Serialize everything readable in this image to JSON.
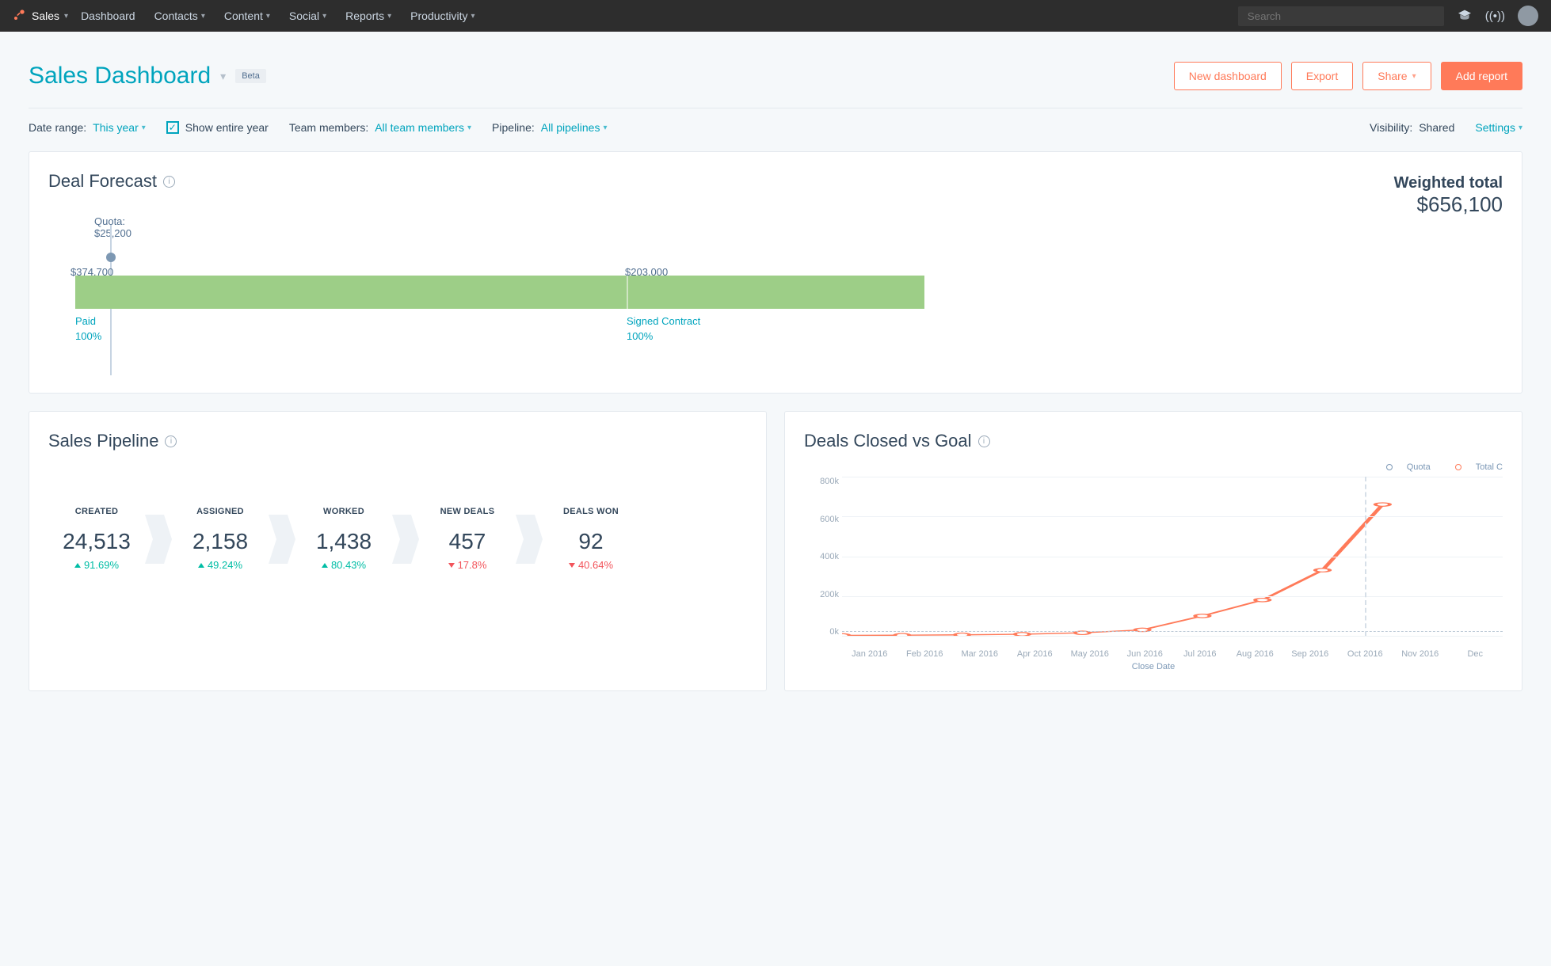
{
  "nav": {
    "brand": "Sales",
    "items": [
      "Dashboard",
      "Contacts",
      "Content",
      "Social",
      "Reports",
      "Productivity"
    ],
    "search_placeholder": "Search"
  },
  "header": {
    "title": "Sales Dashboard",
    "beta": "Beta",
    "buttons": {
      "new_dashboard": "New dashboard",
      "export": "Export",
      "share": "Share",
      "add_report": "Add report"
    }
  },
  "filters": {
    "date_range_label": "Date range:",
    "date_range_value": "This year",
    "show_entire_year": "Show entire year",
    "team_label": "Team members:",
    "team_value": "All team members",
    "pipeline_label": "Pipeline:",
    "pipeline_value": "All pipelines",
    "visibility_label": "Visibility:",
    "visibility_value": "Shared",
    "settings": "Settings"
  },
  "forecast": {
    "title": "Deal Forecast",
    "weighted_label": "Weighted total",
    "weighted_value": "$656,100",
    "quota_label": "Quota:",
    "quota_value": "$25,200",
    "amount1": "$374,700",
    "amount2": "$203,000",
    "stage1_name": "Paid",
    "stage1_pct": "100%",
    "stage2_name": "Signed Contract",
    "stage2_pct": "100%"
  },
  "pipeline": {
    "title": "Sales Pipeline",
    "stages": [
      {
        "name": "CREATED",
        "value": "24,513",
        "change": "91.69%",
        "dir": "up"
      },
      {
        "name": "ASSIGNED",
        "value": "2,158",
        "change": "49.24%",
        "dir": "up"
      },
      {
        "name": "WORKED",
        "value": "1,438",
        "change": "80.43%",
        "dir": "up"
      },
      {
        "name": "NEW DEALS",
        "value": "457",
        "change": "17.8%",
        "dir": "down"
      },
      {
        "name": "DEALS WON",
        "value": "92",
        "change": "40.64%",
        "dir": "down"
      }
    ]
  },
  "deals_chart": {
    "title": "Deals Closed vs Goal",
    "legend_quota": "Quota",
    "legend_total": "Total C",
    "x_axis_title": "Close Date"
  },
  "chart_data": {
    "type": "line",
    "title": "Deals Closed vs Goal",
    "xlabel": "Close Date",
    "ylabel": "",
    "ylim": [
      0,
      800000
    ],
    "yticks": [
      "0k",
      "200k",
      "400k",
      "600k",
      "800k"
    ],
    "categories": [
      "Jan 2016",
      "Feb 2016",
      "Mar 2016",
      "Apr 2016",
      "May 2016",
      "Jun 2016",
      "Jul 2016",
      "Aug 2016",
      "Sep 2016",
      "Oct 2016",
      "Nov 2016",
      "Dec"
    ],
    "series": [
      {
        "name": "Quota",
        "values": [
          25200,
          25200,
          25200,
          25200,
          25200,
          25200,
          25200,
          25200,
          25200,
          25200,
          25200,
          25200
        ],
        "style": "dashed",
        "color": "#7c98b6"
      },
      {
        "name": "Total Closed",
        "values": [
          2000,
          3000,
          5000,
          8000,
          15000,
          30000,
          100000,
          180000,
          330000,
          660000,
          null,
          null
        ],
        "style": "solid",
        "color": "#ff7a59"
      }
    ],
    "today_after_index": 9
  }
}
